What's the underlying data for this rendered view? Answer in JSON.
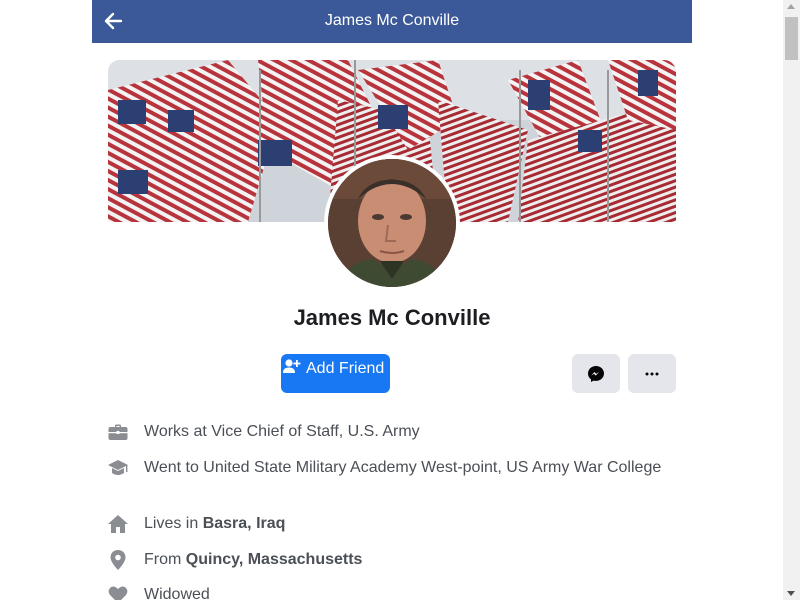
{
  "header": {
    "title": "James Mc Conville",
    "back_icon": "arrow-left-icon"
  },
  "profile": {
    "name": "James Mc Conville",
    "cover_description": "american-flags-cover",
    "avatar_description": "profile-photo"
  },
  "actions": {
    "add_friend_label": "Add Friend",
    "add_friend_icon": "person-plus-icon",
    "messenger_icon": "messenger-icon",
    "more_icon": "more-dots-icon"
  },
  "intro": {
    "work": {
      "prefix": "Works at ",
      "value": "Vice Chief of Staff, U.S. Army",
      "icon": "briefcase-icon"
    },
    "education": {
      "prefix": "Went to ",
      "value": "United State Military Academy West-point, US Army War College",
      "icon": "graduation-cap-icon"
    },
    "lives": {
      "prefix": "Lives in ",
      "value": "Basra, Iraq",
      "icon": "home-icon"
    },
    "from": {
      "prefix": "From ",
      "value": "Quincy, Massachusetts",
      "icon": "location-pin-icon"
    },
    "relationship": {
      "value": "Widowed",
      "icon": "heart-icon"
    }
  },
  "colors": {
    "header_bg": "#3b5998",
    "primary": "#1877f2",
    "button_gray": "#e4e6eb",
    "text": "#4b4f56"
  }
}
